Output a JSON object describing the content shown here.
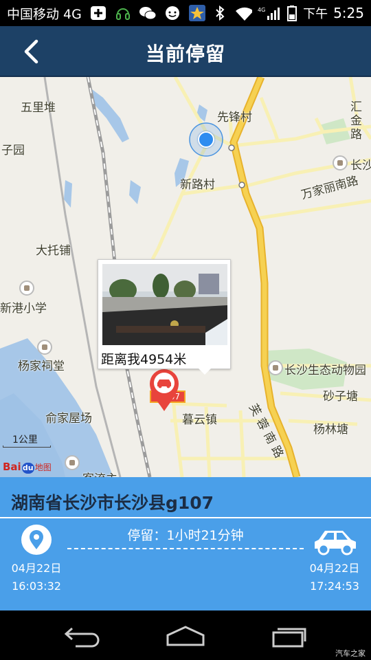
{
  "status_bar": {
    "carrier": "中国移动 4G",
    "network_small": "4G",
    "ampm": "下午",
    "time": "5:25"
  },
  "header": {
    "title": "当前停留"
  },
  "map": {
    "labels": {
      "wulidui": "五里堆",
      "ziyuan": "子园",
      "xianfengcun": "先锋村",
      "huijinlu": "汇金路",
      "changsha_edge": "长沙",
      "xinlucun": "新路村",
      "wanjialinanlu": "万家丽南路",
      "datuopu": "大托铺",
      "xingang": "新港小学",
      "yangjiacitang": "杨家祠堂",
      "zoo": "长沙生态动物园",
      "shazitang": "砂子塘",
      "yujiawuchang": "俞家屋场",
      "muyunzhen": "暮云镇",
      "yanglintang": "杨林塘",
      "furongnanlu": "芙蓉南路",
      "bottom_cut": "客流主",
      "route_badge": "07"
    },
    "scale_label": "1公里",
    "brand": "Bai地图",
    "popup": {
      "distance": "距离我4954米"
    }
  },
  "info_panel": {
    "address": "湖南省长沙市长沙县g107",
    "stay_text": "停留：1小时21分钟",
    "start_date": "04月22日",
    "start_time": "16:03:32",
    "end_date": "04月22日",
    "end_time": "17:24:53"
  },
  "watermark": "汽车之家",
  "colors": {
    "header": "#1d4166",
    "panel": "#4a9fe9",
    "road_major": "#f4c434",
    "location_dot": "#2d8cf0",
    "pin": "#e8443c"
  }
}
